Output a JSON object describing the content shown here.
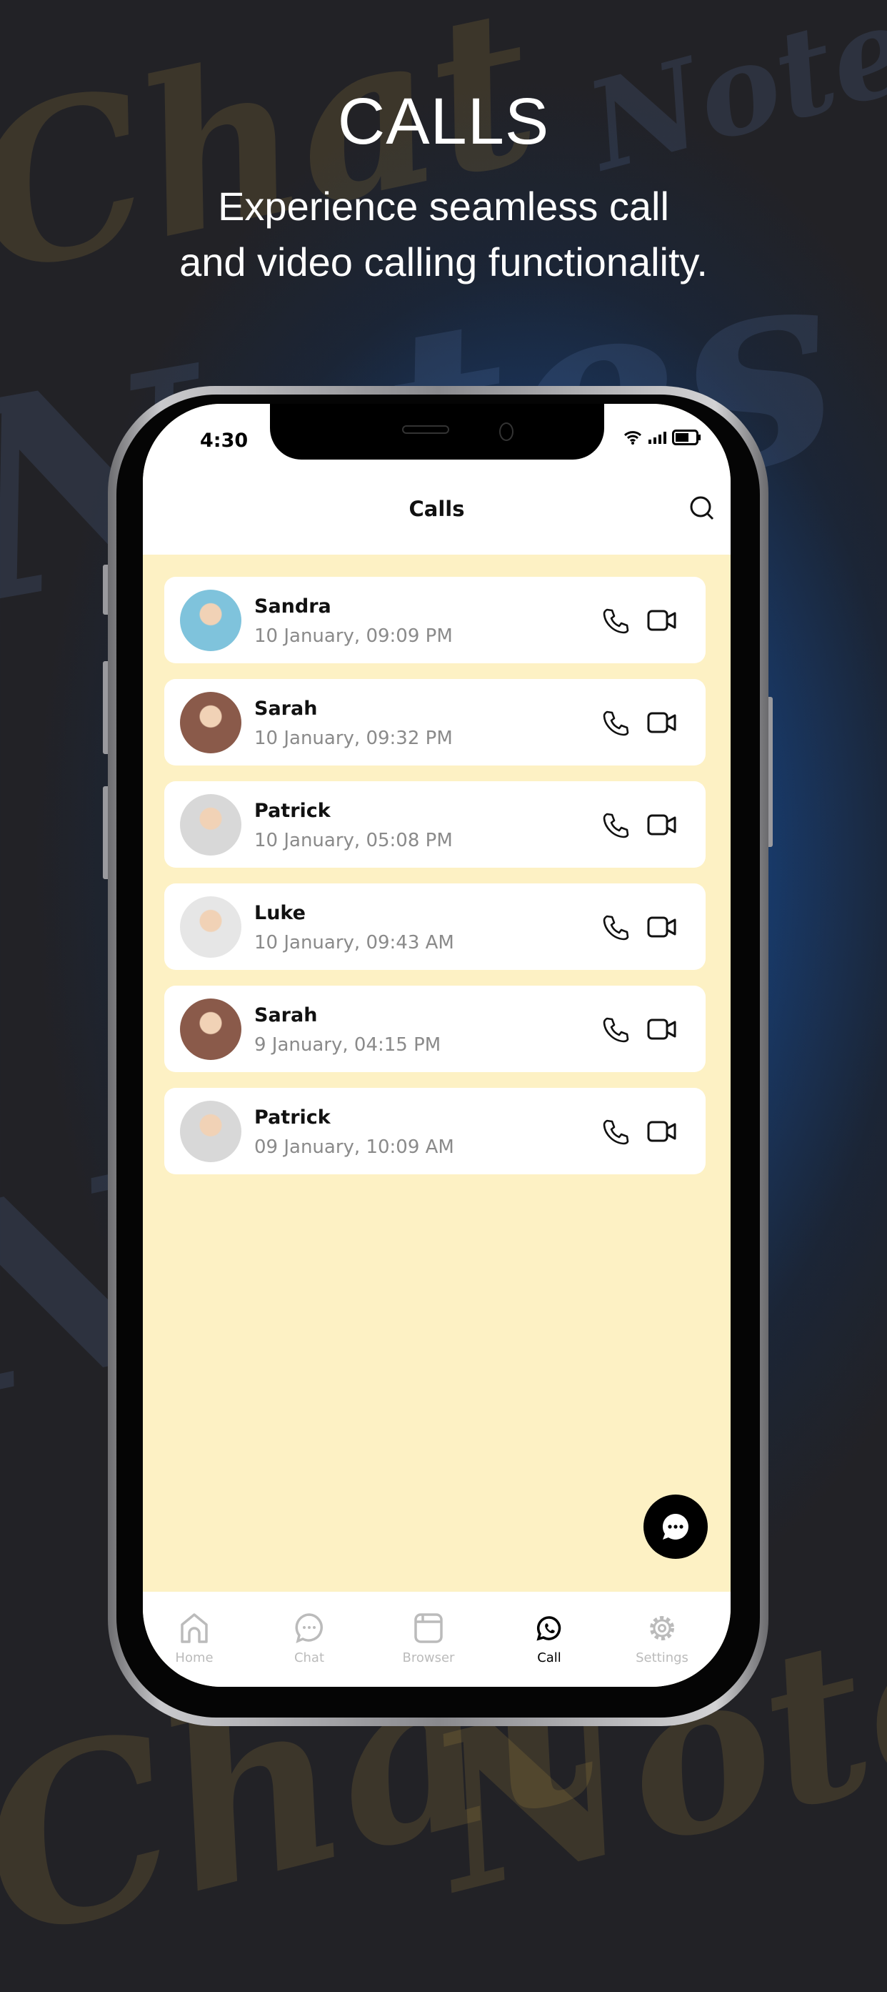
{
  "background": {
    "watermark": [
      "Chat",
      "Notes"
    ]
  },
  "hero": {
    "title": "CALLS",
    "subtitle_line1": "Experience seamless call",
    "subtitle_line2": "and video calling functionality."
  },
  "status_bar": {
    "time": "4:30"
  },
  "header": {
    "title": "Calls",
    "search_icon": "search-icon"
  },
  "calls": [
    {
      "name": "Sandra",
      "time": "10 January, 09:09 PM",
      "avatar_color": "#7fc3dc"
    },
    {
      "name": "Sarah",
      "time": "10 January, 09:32 PM",
      "avatar_color": "#8a5a4a"
    },
    {
      "name": "Patrick",
      "time": "10 January, 05:08 PM",
      "avatar_color": "#d8d8d8"
    },
    {
      "name": "Luke",
      "time": "10 January, 09:43 AM",
      "avatar_color": "#e6e6e6"
    },
    {
      "name": "Sarah",
      "time": "9 January, 04:15 PM",
      "avatar_color": "#8a5a4a"
    },
    {
      "name": "Patrick",
      "time": "09 January, 10:09 AM",
      "avatar_color": "#d8d8d8"
    }
  ],
  "nav": [
    {
      "label": "Home",
      "icon": "home-icon"
    },
    {
      "label": "Chat",
      "icon": "chat-icon"
    },
    {
      "label": "Browser",
      "icon": "browser-icon"
    },
    {
      "label": "Call",
      "icon": "whatsapp-call-icon",
      "active": true
    },
    {
      "label": "Settings",
      "icon": "gear-icon"
    }
  ],
  "colors": {
    "list_background": "#fdf1c4",
    "accent": "#000000",
    "inactive": "#bbbbbb"
  }
}
